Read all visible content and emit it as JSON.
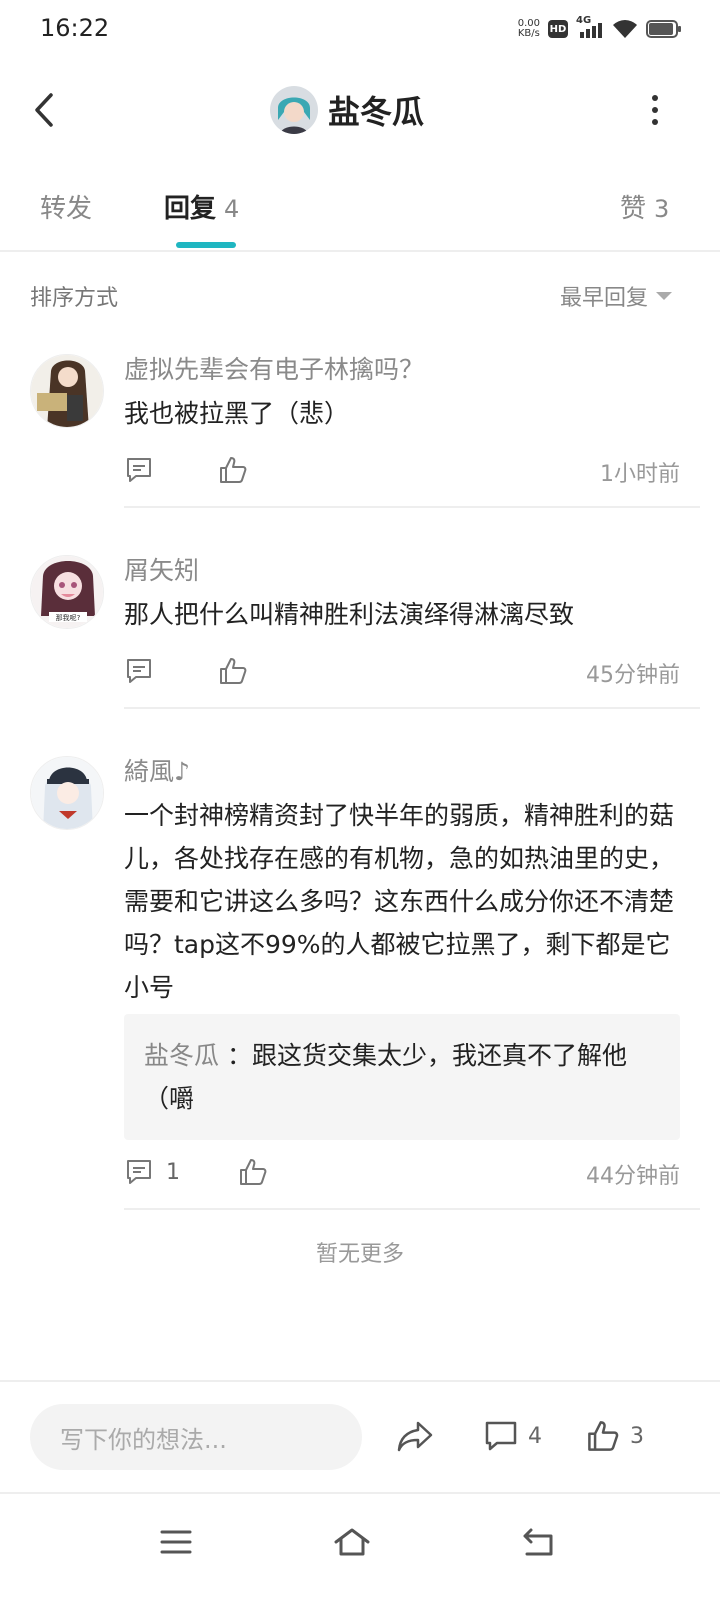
{
  "status_bar": {
    "time": "16:22",
    "net_speed_value": "0.00",
    "net_speed_unit": "KB/s",
    "hd_label": "HD",
    "signal_label": "4G"
  },
  "header": {
    "title": "盐冬瓜"
  },
  "tabs": [
    {
      "label": "转发",
      "count": ""
    },
    {
      "label": "回复",
      "count": "4"
    },
    {
      "label": "赞",
      "count": "3"
    }
  ],
  "sort": {
    "label": "排序方式",
    "value": "最早回复"
  },
  "comments": [
    {
      "name": "虚拟先辈会有电子林擒吗？",
      "body": "我也被拉黑了（悲）",
      "reply_count": "",
      "time": "1小时前"
    },
    {
      "name": "屑矢矧",
      "body": "那人把什么叫精神胜利法演绎得淋漓尽致",
      "reply_count": "",
      "time": "45分钟前"
    },
    {
      "name": "綺風♪",
      "body": "一个封神榜精资封了快半年的弱质，精神胜利的菇儿，各处找存在感的有机物，急的如热油里的史，需要和它讲这么多吗？这东西什么成分你还不清楚吗？tap这不99%的人都被它拉黑了，剩下都是它小号",
      "quote_author": "盐冬瓜",
      "quote_text": "：跟这货交集太少，我还真不了解他（嚼",
      "reply_count": "1",
      "time": "44分钟前"
    }
  ],
  "no_more": "暂无更多",
  "bottom_bar": {
    "input_placeholder": "写下你的想法...",
    "comment_count": "4",
    "like_count": "3"
  },
  "colors": {
    "accent": "#1fb6c1",
    "text_primary": "#222222",
    "text_secondary": "#888888"
  }
}
